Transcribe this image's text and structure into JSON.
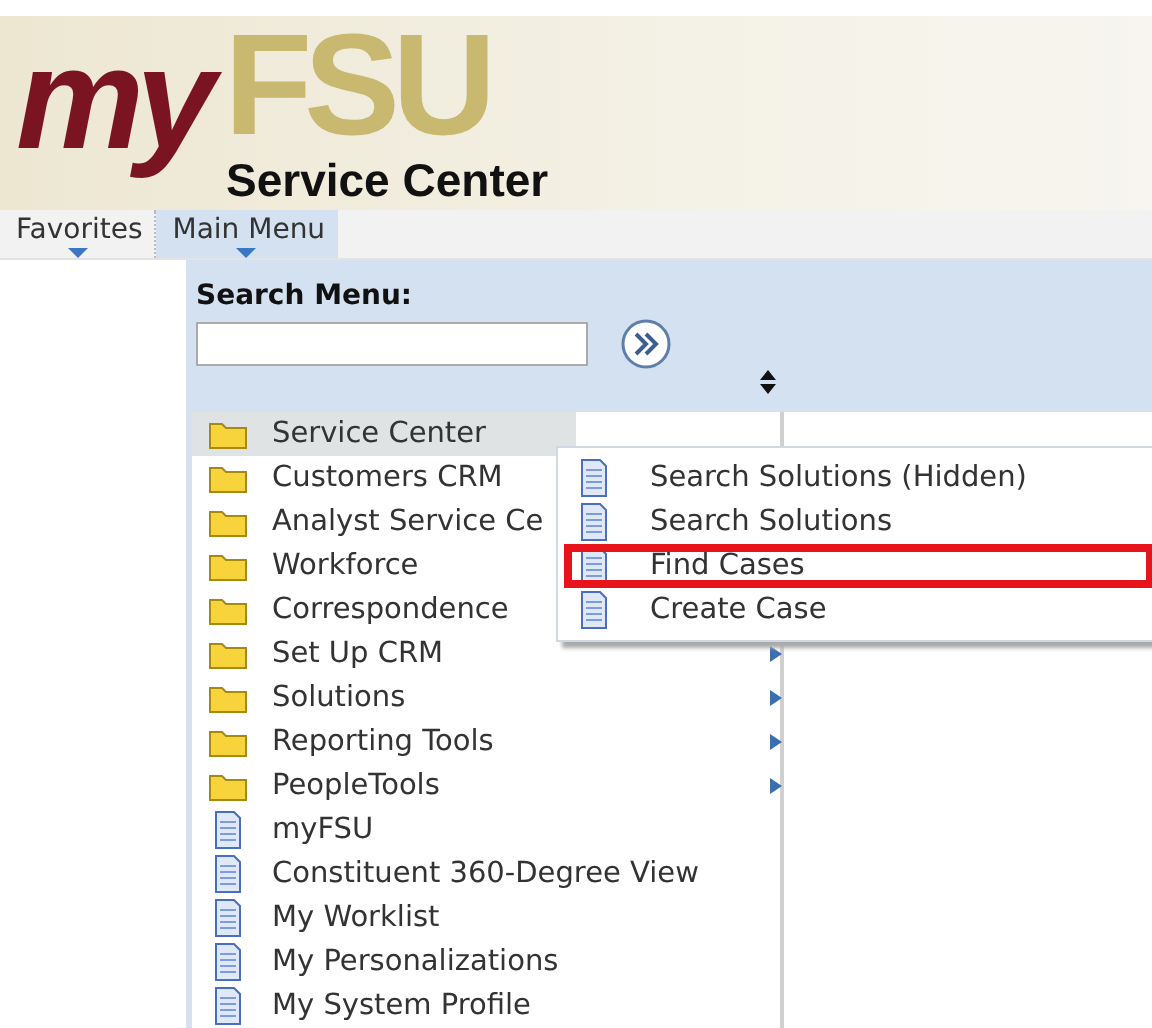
{
  "header": {
    "logo_part_1": "my",
    "logo_part_2": "FSU",
    "title": "Service Center"
  },
  "menubar": [
    {
      "label": "Favorites",
      "selected": false
    },
    {
      "label": "Main Menu",
      "selected": true
    }
  ],
  "search": {
    "label": "Search Menu:"
  },
  "menu": [
    {
      "kind": "folder",
      "label": "Service Center",
      "hovered": true,
      "has_submenu": false
    },
    {
      "kind": "folder",
      "label": "Customers CRM",
      "hovered": false,
      "has_submenu": false
    },
    {
      "kind": "folder",
      "label": "Analyst Service Ce",
      "hovered": false,
      "has_submenu": false
    },
    {
      "kind": "folder",
      "label": "Workforce",
      "hovered": false,
      "has_submenu": false
    },
    {
      "kind": "folder",
      "label": "Correspondence",
      "hovered": false,
      "has_submenu": false
    },
    {
      "kind": "folder",
      "label": "Set Up CRM",
      "hovered": false,
      "has_submenu": true
    },
    {
      "kind": "folder",
      "label": "Solutions",
      "hovered": false,
      "has_submenu": true
    },
    {
      "kind": "folder",
      "label": "Reporting Tools",
      "hovered": false,
      "has_submenu": true
    },
    {
      "kind": "folder",
      "label": "PeopleTools",
      "hovered": false,
      "has_submenu": true
    },
    {
      "kind": "page",
      "label": "myFSU",
      "hovered": false,
      "has_submenu": false
    },
    {
      "kind": "page",
      "label": "Constituent 360-Degree View",
      "hovered": false,
      "has_submenu": false
    },
    {
      "kind": "page",
      "label": "My Worklist",
      "hovered": false,
      "has_submenu": false
    },
    {
      "kind": "page",
      "label": "My Personalizations",
      "hovered": false,
      "has_submenu": false
    },
    {
      "kind": "page",
      "label": "My System Profile",
      "hovered": false,
      "has_submenu": false
    }
  ],
  "submenu": [
    {
      "label": "Search Solutions (Hidden)",
      "highlighted": false
    },
    {
      "label": "Search Solutions",
      "highlighted": false
    },
    {
      "label": "Find Cases",
      "highlighted": true
    },
    {
      "label": "Create Case",
      "highlighted": false
    }
  ]
}
